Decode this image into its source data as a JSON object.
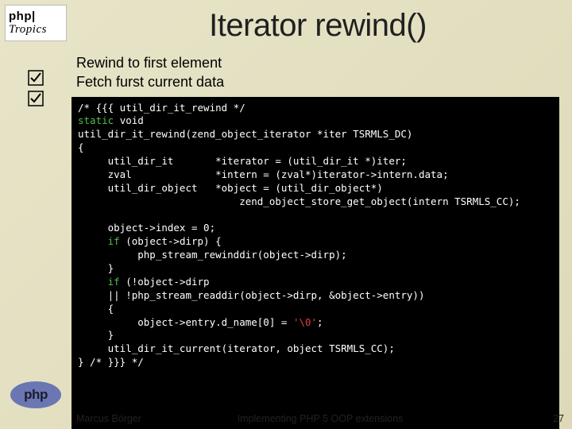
{
  "header": {
    "logo_top_line1": "php|",
    "logo_top_line2": "Tropics",
    "logo_bottom": "php"
  },
  "title": "Iterator rewind()",
  "bullets": [
    "Rewind to first element",
    "Fetch furst current data"
  ],
  "code": {
    "l01": "/* {{{ util_dir_it_rewind */",
    "l02a": "static ",
    "l02b": "void",
    "l03": "util_dir_it_rewind(zend_object_iterator *iter TSRMLS_DC)",
    "l04": "{",
    "l05": "     util_dir_it       *iterator = (util_dir_it *)iter;",
    "l06": "     zval              *intern = (zval*)iterator->intern.data;",
    "l07": "     util_dir_object   *object = (util_dir_object*)",
    "l08": "                           zend_object_store_get_object(intern TSRMLS_CC);",
    "l09": "",
    "l10": "     object->index = 0;",
    "l11a": "     ",
    "l11b": "if",
    "l11c": " (object->dirp) {",
    "l12": "          php_stream_rewinddir(object->dirp);",
    "l13": "     }",
    "l14a": "     ",
    "l14b": "if",
    "l14c": " (!object->dirp",
    "l15": "     || !php_stream_readdir(object->dirp, &object->entry))",
    "l16": "     {",
    "l17a": "          object->entry.d_name[0] = ",
    "l17b": "'\\0'",
    "l17c": ";",
    "l18": "     }",
    "l19": "     util_dir_it_current(iterator, object TSRMLS_CC);",
    "l20": "} /* }}} */"
  },
  "footer": {
    "author": "Marcus Börger",
    "title": "Implementing PHP 5 OOP extensions",
    "page": "27"
  }
}
